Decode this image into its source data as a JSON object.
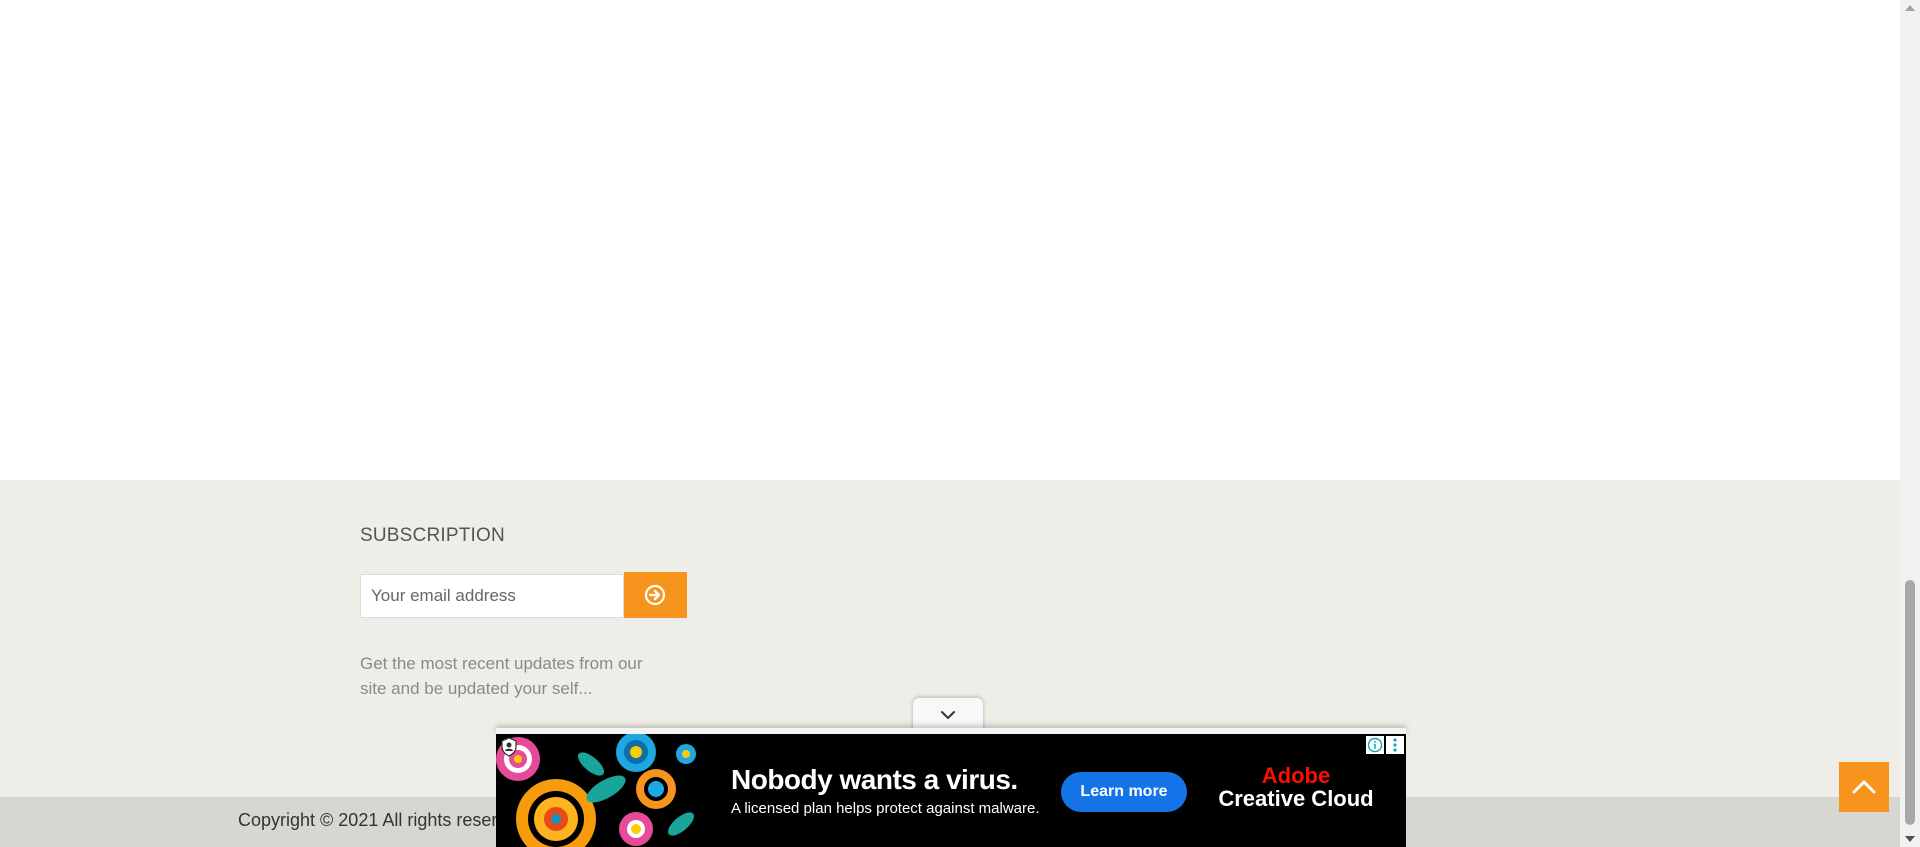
{
  "footer": {
    "subscription_title": "SUBSCRIPTION",
    "email_placeholder": "Your email address",
    "description": "Get the most recent updates from our site and be updated your self...",
    "copyright": "Copyright © 2021 All rights reserv"
  },
  "ad": {
    "headline": "Nobody wants a virus.",
    "subtext": "A licensed plan helps protect against malware.",
    "cta": "Learn more",
    "brand_line1": "Adobe",
    "brand_line2": "Creative Cloud"
  },
  "icons": {
    "submit": "arrow-circle-right-icon",
    "back_to_top": "chevron-up-icon",
    "ad_collapse": "chevron-down-icon",
    "ad_info": "info-icon",
    "ad_menu": "kebab-menu-icon"
  },
  "colors": {
    "accent": "#f7941d",
    "footer_bg": "#efede7",
    "bottom_bar_bg": "#d7d6d0",
    "ad_cta": "#1473e6",
    "adobe_red": "#fa0f00"
  }
}
